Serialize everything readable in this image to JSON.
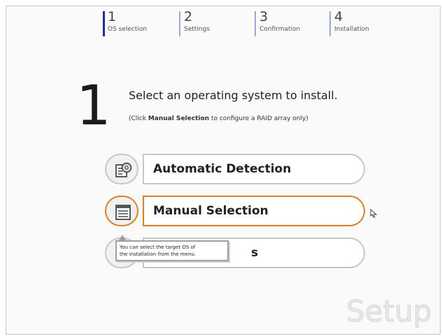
{
  "steps": [
    {
      "number": "1",
      "label": "OS selection",
      "active": true
    },
    {
      "number": "2",
      "label": "Settings",
      "active": false
    },
    {
      "number": "3",
      "label": "Confirmation",
      "active": false
    },
    {
      "number": "4",
      "label": "Installation",
      "active": false
    }
  ],
  "instruction": {
    "step_number": "1",
    "title": "Select an operating system to install.",
    "sub_prefix": "(Click ",
    "sub_bold": "Manual Selection",
    "sub_suffix": " to configure a RAID array only)"
  },
  "options": [
    {
      "label": "Automatic Detection",
      "icon": "disc-drive-icon",
      "selected": false
    },
    {
      "label": "Manual Selection",
      "icon": "list-window-icon",
      "selected": true
    },
    {
      "label": "s",
      "icon": "hidden-option-icon",
      "selected": false
    }
  ],
  "tooltip": {
    "line1": "You can select the target OS of",
    "line2": "the installation from the menu."
  },
  "watermark": "Setup",
  "colors": {
    "accent_orange": "#e57e1e",
    "step_active": "#1f2a9e",
    "step_inactive": "#9aa7e6"
  }
}
